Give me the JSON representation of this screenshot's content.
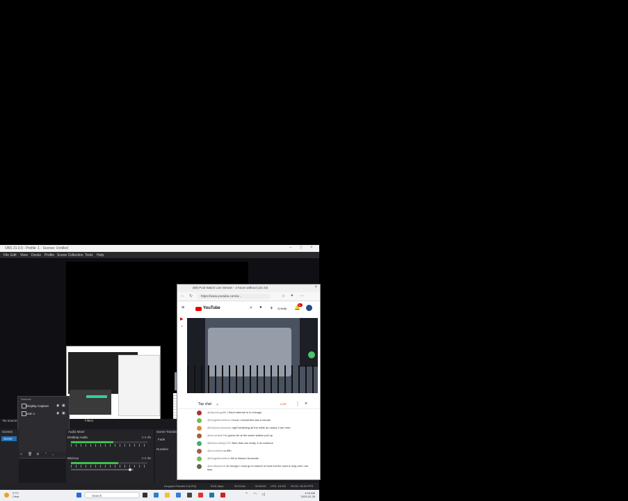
{
  "obs": {
    "title": "OBS 31.0.0 - Profile: 1 - Scenes: Untitled",
    "menu": [
      "File",
      "Edit",
      "View",
      "Docks",
      "Profile",
      "Scene Collection",
      "Tools",
      "Help"
    ],
    "sources_header": "Sources",
    "sources": [
      {
        "label": "Display Capture"
      },
      {
        "label": "cam 1"
      }
    ],
    "no_source": "No source",
    "filters_tab": "Filters",
    "scenes_header": "Scenes",
    "scene_selected": "Scene",
    "mixer_header": "Audio Mixer",
    "mixer_tracks": [
      {
        "name": "Desktop Audio",
        "db": "0.0 dB",
        "level": 0.55
      },
      {
        "name": "Mic/Aux",
        "db": "0.0 dB",
        "level": 0.62
      }
    ],
    "transitions_header": "Scene Transitions",
    "transition_value": "Fade",
    "duration_label": "Duration",
    "status": {
      "dropped": "Dropped Frames 0 (0.0%)",
      "bitrate": "6131 kbps",
      "live": "00:24:48",
      "rec": "00:00:00",
      "cpu": "CPU: 16.0%",
      "fps": "30.00 / 30.00 FPS"
    }
  },
  "browser": {
    "tab_title": "(69) Pool Watch Live Stream - 2 hours without (Jul 23)",
    "url": "https://www.youtube.com/w...",
    "yt_brand": "YouTube",
    "create_label": "Create",
    "notification_count": "9+",
    "chat": {
      "title": "Top chat",
      "badge": "LIVE",
      "messages": [
        {
          "user": "@stephengalllo",
          "text": "I think bahrhuk is in chicago",
          "color": "#a33"
        },
        {
          "user": "@SingleMomMom",
          "text": "I know I rebuilt this last a minute",
          "color": "#7b5"
        },
        {
          "user": "@hollywoodsnacks",
          "text": "right breathing all the while as nearly 4 am here",
          "color": "#d84"
        },
        {
          "user": "@sunsetball",
          "text": "I'm gonna be at the same station pull up",
          "color": "#963"
        },
        {
          "user": "@fullsounding1222",
          "text": "Bars that use today 4 ds continue",
          "color": "#4a7"
        },
        {
          "user": "@uncooked",
          "text": "no fifth",
          "color": "#a55"
        },
        {
          "user": "@SingleMomMom",
          "text": "Bit in Nelson Nunsville",
          "color": "#7b5"
        },
        {
          "user": "@motleybored",
          "text": "oh hungry I must go in search of food but the road is long and I am lazy",
          "color": "#664"
        }
      ]
    }
  },
  "taskbar": {
    "weather_temp": "27°C",
    "weather_desc": "Clear",
    "search_placeholder": "Search",
    "time": "4:24 AM",
    "date": "2025-02-28"
  }
}
